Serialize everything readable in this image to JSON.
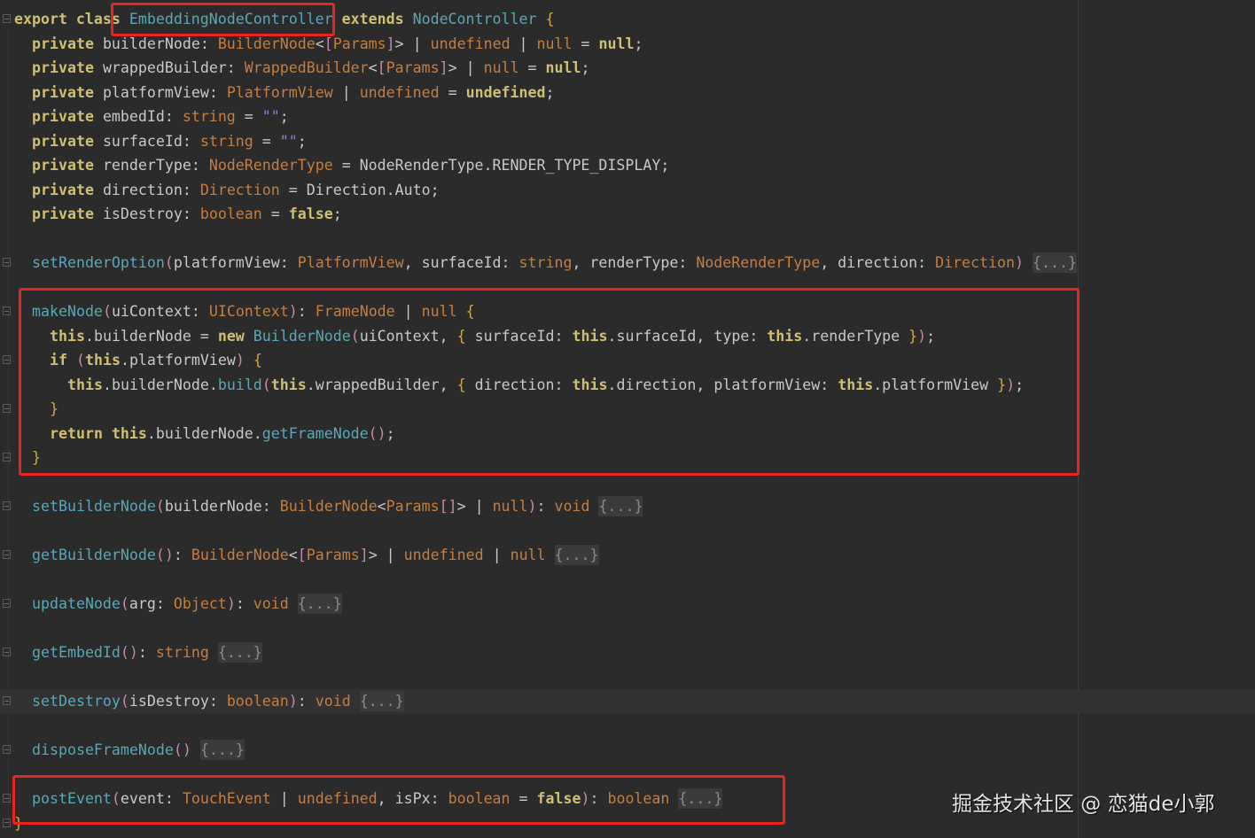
{
  "code": {
    "lines": [
      {
        "i": 0,
        "fold": true,
        "t": [
          [
            "k",
            "export class "
          ],
          [
            "f",
            "EmbeddingNodeController"
          ],
          [
            "p",
            " "
          ],
          [
            "k",
            "extends "
          ],
          [
            "f",
            "NodeController"
          ],
          [
            "p",
            " "
          ],
          [
            "c",
            "{"
          ]
        ]
      },
      {
        "i": 1,
        "t": [
          [
            "k",
            "private "
          ],
          [
            "p",
            "builderNode: "
          ],
          [
            "t",
            "BuilderNode"
          ],
          [
            "p",
            "<"
          ],
          [
            "b",
            "["
          ],
          [
            "t",
            "Params"
          ],
          [
            "b",
            "]"
          ],
          [
            "p",
            "> | "
          ],
          [
            "t",
            "undefined"
          ],
          [
            "p",
            " | "
          ],
          [
            "t",
            "null"
          ],
          [
            "p",
            " = "
          ],
          [
            "k",
            "null"
          ],
          [
            "p",
            ";"
          ]
        ]
      },
      {
        "i": 1,
        "t": [
          [
            "k",
            "private "
          ],
          [
            "p",
            "wrappedBuilder: "
          ],
          [
            "t",
            "WrappedBuilder"
          ],
          [
            "p",
            "<"
          ],
          [
            "b",
            "["
          ],
          [
            "t",
            "Params"
          ],
          [
            "b",
            "]"
          ],
          [
            "p",
            "> | "
          ],
          [
            "t",
            "null"
          ],
          [
            "p",
            " = "
          ],
          [
            "k",
            "null"
          ],
          [
            "p",
            ";"
          ]
        ]
      },
      {
        "i": 1,
        "t": [
          [
            "k",
            "private "
          ],
          [
            "p",
            "platformView: "
          ],
          [
            "t",
            "PlatformView"
          ],
          [
            "p",
            " | "
          ],
          [
            "t",
            "undefined"
          ],
          [
            "p",
            " = "
          ],
          [
            "k",
            "undefined"
          ],
          [
            "p",
            ";"
          ]
        ]
      },
      {
        "i": 1,
        "t": [
          [
            "k",
            "private "
          ],
          [
            "p",
            "embedId: "
          ],
          [
            "t",
            "string"
          ],
          [
            "p",
            " = "
          ],
          [
            "s",
            "\"\""
          ],
          [
            "p",
            ";"
          ]
        ]
      },
      {
        "i": 1,
        "t": [
          [
            "k",
            "private "
          ],
          [
            "p",
            "surfaceId: "
          ],
          [
            "t",
            "string"
          ],
          [
            "p",
            " = "
          ],
          [
            "s",
            "\"\""
          ],
          [
            "p",
            ";"
          ]
        ]
      },
      {
        "i": 1,
        "t": [
          [
            "k",
            "private "
          ],
          [
            "p",
            "renderType: "
          ],
          [
            "t",
            "NodeRenderType"
          ],
          [
            "p",
            " = NodeRenderType.RENDER_TYPE_DISPLAY;"
          ]
        ]
      },
      {
        "i": 1,
        "t": [
          [
            "k",
            "private "
          ],
          [
            "p",
            "direction: "
          ],
          [
            "t",
            "Direction"
          ],
          [
            "p",
            " = Direction.Auto;"
          ]
        ]
      },
      {
        "i": 1,
        "t": [
          [
            "k",
            "private "
          ],
          [
            "p",
            "isDestroy: "
          ],
          [
            "t",
            "boolean"
          ],
          [
            "p",
            " = "
          ],
          [
            "k",
            "false"
          ],
          [
            "p",
            ";"
          ]
        ]
      },
      {
        "i": 1,
        "t": []
      },
      {
        "i": 1,
        "fold": true,
        "t": [
          [
            "f",
            "setRenderOption"
          ],
          [
            "b",
            "("
          ],
          [
            "p",
            "platformView: "
          ],
          [
            "t",
            "PlatformView"
          ],
          [
            "p",
            ", surfaceId: "
          ],
          [
            "t",
            "string"
          ],
          [
            "p",
            ", renderType: "
          ],
          [
            "t",
            "NodeRenderType"
          ],
          [
            "p",
            ", direction: "
          ],
          [
            "t",
            "Direction"
          ],
          [
            "b",
            ")"
          ],
          [
            "p",
            " "
          ],
          [
            "z",
            "{...}"
          ]
        ]
      },
      {
        "i": 1,
        "t": []
      },
      {
        "i": 1,
        "fold": true,
        "t": [
          [
            "f",
            "makeNode"
          ],
          [
            "b",
            "("
          ],
          [
            "p",
            "uiContext: "
          ],
          [
            "t",
            "UIContext"
          ],
          [
            "b",
            ")"
          ],
          [
            "p",
            ": "
          ],
          [
            "t",
            "FrameNode"
          ],
          [
            "p",
            " | "
          ],
          [
            "t",
            "null"
          ],
          [
            "p",
            " "
          ],
          [
            "c",
            "{"
          ]
        ]
      },
      {
        "i": 2,
        "t": [
          [
            "k",
            "this"
          ],
          [
            "p",
            ".builderNode = "
          ],
          [
            "k",
            "new "
          ],
          [
            "f",
            "BuilderNode"
          ],
          [
            "b",
            "("
          ],
          [
            "p",
            "uiContext, "
          ],
          [
            "c",
            "{"
          ],
          [
            "p",
            " surfaceId: "
          ],
          [
            "k",
            "this"
          ],
          [
            "p",
            ".surfaceId, type: "
          ],
          [
            "k",
            "this"
          ],
          [
            "p",
            ".renderType "
          ],
          [
            "c",
            "}"
          ],
          [
            "b",
            ")"
          ],
          [
            "p",
            ";"
          ]
        ]
      },
      {
        "i": 2,
        "fold": true,
        "t": [
          [
            "k",
            "if "
          ],
          [
            "b",
            "("
          ],
          [
            "k",
            "this"
          ],
          [
            "p",
            ".platformView"
          ],
          [
            "b",
            ")"
          ],
          [
            "p",
            " "
          ],
          [
            "c",
            "{"
          ]
        ]
      },
      {
        "i": 3,
        "t": [
          [
            "k",
            "this"
          ],
          [
            "p",
            ".builderNode."
          ],
          [
            "f",
            "build"
          ],
          [
            "b",
            "("
          ],
          [
            "k",
            "this"
          ],
          [
            "p",
            ".wrappedBuilder, "
          ],
          [
            "c",
            "{"
          ],
          [
            "p",
            " direction: "
          ],
          [
            "k",
            "this"
          ],
          [
            "p",
            ".direction, platformView: "
          ],
          [
            "k",
            "this"
          ],
          [
            "p",
            ".platformView "
          ],
          [
            "c",
            "}"
          ],
          [
            "b",
            ")"
          ],
          [
            "p",
            ";"
          ]
        ]
      },
      {
        "i": 2,
        "fold": true,
        "t": [
          [
            "c",
            "}"
          ]
        ]
      },
      {
        "i": 2,
        "t": [
          [
            "k",
            "return "
          ],
          [
            "k",
            "this"
          ],
          [
            "p",
            ".builderNode."
          ],
          [
            "f",
            "getFrameNode"
          ],
          [
            "b",
            "()"
          ],
          [
            "p",
            ";"
          ]
        ]
      },
      {
        "i": 1,
        "fold": true,
        "t": [
          [
            "c",
            "}"
          ]
        ]
      },
      {
        "i": 1,
        "t": []
      },
      {
        "i": 1,
        "fold": true,
        "t": [
          [
            "f",
            "setBuilderNode"
          ],
          [
            "b",
            "("
          ],
          [
            "p",
            "builderNode: "
          ],
          [
            "t",
            "BuilderNode"
          ],
          [
            "p",
            "<"
          ],
          [
            "t",
            "Params"
          ],
          [
            "b",
            "[]"
          ],
          [
            "p",
            "> | "
          ],
          [
            "t",
            "null"
          ],
          [
            "b",
            ")"
          ],
          [
            "p",
            ": "
          ],
          [
            "t",
            "void"
          ],
          [
            "p",
            " "
          ],
          [
            "z",
            "{...}"
          ]
        ]
      },
      {
        "i": 1,
        "t": []
      },
      {
        "i": 1,
        "fold": true,
        "t": [
          [
            "f",
            "getBuilderNode"
          ],
          [
            "b",
            "()"
          ],
          [
            "p",
            ": "
          ],
          [
            "t",
            "BuilderNode"
          ],
          [
            "p",
            "<"
          ],
          [
            "b",
            "["
          ],
          [
            "t",
            "Params"
          ],
          [
            "b",
            "]"
          ],
          [
            "p",
            "> | "
          ],
          [
            "t",
            "undefined"
          ],
          [
            "p",
            " | "
          ],
          [
            "t",
            "null"
          ],
          [
            "p",
            " "
          ],
          [
            "z",
            "{...}"
          ]
        ]
      },
      {
        "i": 1,
        "t": []
      },
      {
        "i": 1,
        "fold": true,
        "t": [
          [
            "f",
            "updateNode"
          ],
          [
            "b",
            "("
          ],
          [
            "p",
            "arg: "
          ],
          [
            "t",
            "Object"
          ],
          [
            "b",
            ")"
          ],
          [
            "p",
            ": "
          ],
          [
            "t",
            "void"
          ],
          [
            "p",
            " "
          ],
          [
            "z",
            "{...}"
          ]
        ]
      },
      {
        "i": 1,
        "t": []
      },
      {
        "i": 1,
        "fold": true,
        "t": [
          [
            "f",
            "getEmbedId"
          ],
          [
            "b",
            "()"
          ],
          [
            "p",
            ": "
          ],
          [
            "t",
            "string"
          ],
          [
            "p",
            " "
          ],
          [
            "z",
            "{...}"
          ]
        ]
      },
      {
        "i": 1,
        "t": []
      },
      {
        "i": 1,
        "fold": true,
        "hl": true,
        "t": [
          [
            "f",
            "setDestroy"
          ],
          [
            "b",
            "("
          ],
          [
            "p",
            "isDestroy: "
          ],
          [
            "t",
            "boolean"
          ],
          [
            "b",
            ")"
          ],
          [
            "p",
            ": "
          ],
          [
            "t",
            "void"
          ],
          [
            "p",
            " "
          ],
          [
            "z",
            "{...}"
          ]
        ]
      },
      {
        "i": 1,
        "t": []
      },
      {
        "i": 1,
        "fold": true,
        "t": [
          [
            "f",
            "disposeFrameNode"
          ],
          [
            "b",
            "()"
          ],
          [
            "p",
            " "
          ],
          [
            "z",
            "{...}"
          ]
        ]
      },
      {
        "i": 1,
        "t": []
      },
      {
        "i": 1,
        "fold": true,
        "t": [
          [
            "f",
            "postEvent"
          ],
          [
            "b",
            "("
          ],
          [
            "p",
            "event: "
          ],
          [
            "t",
            "TouchEvent"
          ],
          [
            "p",
            " | "
          ],
          [
            "t",
            "undefined"
          ],
          [
            "p",
            ", isPx: "
          ],
          [
            "t",
            "boolean"
          ],
          [
            "p",
            " = "
          ],
          [
            "k",
            "false"
          ],
          [
            "b",
            ")"
          ],
          [
            "p",
            ": "
          ],
          [
            "t",
            "boolean"
          ],
          [
            "p",
            " "
          ],
          [
            "z",
            "{...}"
          ]
        ]
      },
      {
        "i": 0,
        "fold": true,
        "t": [
          [
            "c",
            "}"
          ]
        ]
      }
    ]
  },
  "watermark": "掘金技术社区 @ 恋猫de小郭",
  "colors": {
    "background": "#2b2b2b",
    "highlight_box": "#e8241f",
    "keyword": "#cfbf72",
    "function": "#56a8b8",
    "type": "#c77d3b"
  }
}
